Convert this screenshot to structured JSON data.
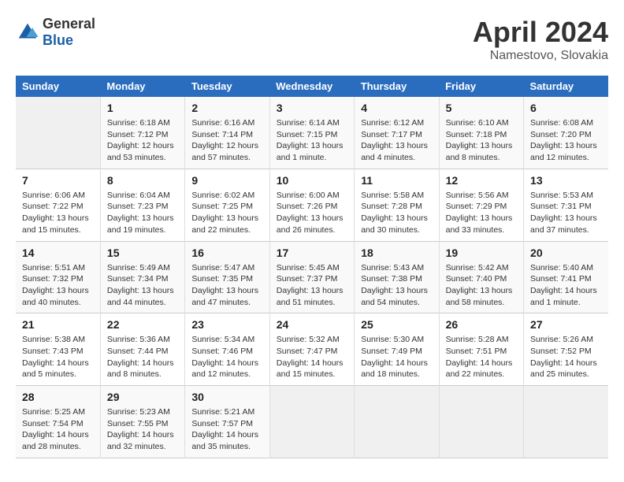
{
  "header": {
    "logo_general": "General",
    "logo_blue": "Blue",
    "title": "April 2024",
    "location": "Namestovo, Slovakia"
  },
  "columns": [
    "Sunday",
    "Monday",
    "Tuesday",
    "Wednesday",
    "Thursday",
    "Friday",
    "Saturday"
  ],
  "weeks": [
    [
      {
        "day": "",
        "info": ""
      },
      {
        "day": "1",
        "info": "Sunrise: 6:18 AM\nSunset: 7:12 PM\nDaylight: 12 hours\nand 53 minutes."
      },
      {
        "day": "2",
        "info": "Sunrise: 6:16 AM\nSunset: 7:14 PM\nDaylight: 12 hours\nand 57 minutes."
      },
      {
        "day": "3",
        "info": "Sunrise: 6:14 AM\nSunset: 7:15 PM\nDaylight: 13 hours\nand 1 minute."
      },
      {
        "day": "4",
        "info": "Sunrise: 6:12 AM\nSunset: 7:17 PM\nDaylight: 13 hours\nand 4 minutes."
      },
      {
        "day": "5",
        "info": "Sunrise: 6:10 AM\nSunset: 7:18 PM\nDaylight: 13 hours\nand 8 minutes."
      },
      {
        "day": "6",
        "info": "Sunrise: 6:08 AM\nSunset: 7:20 PM\nDaylight: 13 hours\nand 12 minutes."
      }
    ],
    [
      {
        "day": "7",
        "info": "Sunrise: 6:06 AM\nSunset: 7:22 PM\nDaylight: 13 hours\nand 15 minutes."
      },
      {
        "day": "8",
        "info": "Sunrise: 6:04 AM\nSunset: 7:23 PM\nDaylight: 13 hours\nand 19 minutes."
      },
      {
        "day": "9",
        "info": "Sunrise: 6:02 AM\nSunset: 7:25 PM\nDaylight: 13 hours\nand 22 minutes."
      },
      {
        "day": "10",
        "info": "Sunrise: 6:00 AM\nSunset: 7:26 PM\nDaylight: 13 hours\nand 26 minutes."
      },
      {
        "day": "11",
        "info": "Sunrise: 5:58 AM\nSunset: 7:28 PM\nDaylight: 13 hours\nand 30 minutes."
      },
      {
        "day": "12",
        "info": "Sunrise: 5:56 AM\nSunset: 7:29 PM\nDaylight: 13 hours\nand 33 minutes."
      },
      {
        "day": "13",
        "info": "Sunrise: 5:53 AM\nSunset: 7:31 PM\nDaylight: 13 hours\nand 37 minutes."
      }
    ],
    [
      {
        "day": "14",
        "info": "Sunrise: 5:51 AM\nSunset: 7:32 PM\nDaylight: 13 hours\nand 40 minutes."
      },
      {
        "day": "15",
        "info": "Sunrise: 5:49 AM\nSunset: 7:34 PM\nDaylight: 13 hours\nand 44 minutes."
      },
      {
        "day": "16",
        "info": "Sunrise: 5:47 AM\nSunset: 7:35 PM\nDaylight: 13 hours\nand 47 minutes."
      },
      {
        "day": "17",
        "info": "Sunrise: 5:45 AM\nSunset: 7:37 PM\nDaylight: 13 hours\nand 51 minutes."
      },
      {
        "day": "18",
        "info": "Sunrise: 5:43 AM\nSunset: 7:38 PM\nDaylight: 13 hours\nand 54 minutes."
      },
      {
        "day": "19",
        "info": "Sunrise: 5:42 AM\nSunset: 7:40 PM\nDaylight: 13 hours\nand 58 minutes."
      },
      {
        "day": "20",
        "info": "Sunrise: 5:40 AM\nSunset: 7:41 PM\nDaylight: 14 hours\nand 1 minute."
      }
    ],
    [
      {
        "day": "21",
        "info": "Sunrise: 5:38 AM\nSunset: 7:43 PM\nDaylight: 14 hours\nand 5 minutes."
      },
      {
        "day": "22",
        "info": "Sunrise: 5:36 AM\nSunset: 7:44 PM\nDaylight: 14 hours\nand 8 minutes."
      },
      {
        "day": "23",
        "info": "Sunrise: 5:34 AM\nSunset: 7:46 PM\nDaylight: 14 hours\nand 12 minutes."
      },
      {
        "day": "24",
        "info": "Sunrise: 5:32 AM\nSunset: 7:47 PM\nDaylight: 14 hours\nand 15 minutes."
      },
      {
        "day": "25",
        "info": "Sunrise: 5:30 AM\nSunset: 7:49 PM\nDaylight: 14 hours\nand 18 minutes."
      },
      {
        "day": "26",
        "info": "Sunrise: 5:28 AM\nSunset: 7:51 PM\nDaylight: 14 hours\nand 22 minutes."
      },
      {
        "day": "27",
        "info": "Sunrise: 5:26 AM\nSunset: 7:52 PM\nDaylight: 14 hours\nand 25 minutes."
      }
    ],
    [
      {
        "day": "28",
        "info": "Sunrise: 5:25 AM\nSunset: 7:54 PM\nDaylight: 14 hours\nand 28 minutes."
      },
      {
        "day": "29",
        "info": "Sunrise: 5:23 AM\nSunset: 7:55 PM\nDaylight: 14 hours\nand 32 minutes."
      },
      {
        "day": "30",
        "info": "Sunrise: 5:21 AM\nSunset: 7:57 PM\nDaylight: 14 hours\nand 35 minutes."
      },
      {
        "day": "",
        "info": ""
      },
      {
        "day": "",
        "info": ""
      },
      {
        "day": "",
        "info": ""
      },
      {
        "day": "",
        "info": ""
      }
    ]
  ]
}
